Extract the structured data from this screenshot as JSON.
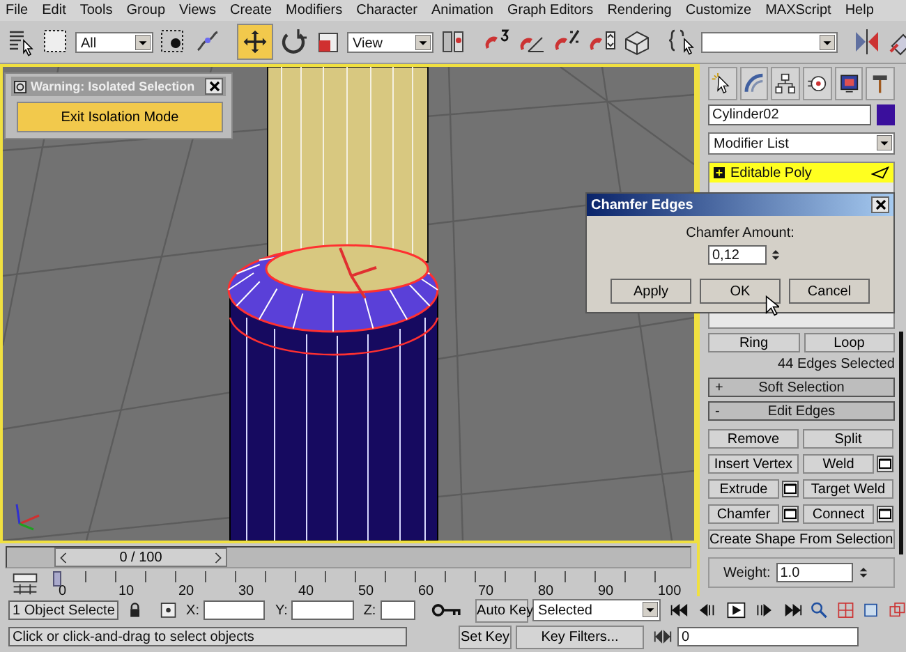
{
  "menu": [
    "File",
    "Edit",
    "Tools",
    "Group",
    "Views",
    "Create",
    "Modifiers",
    "Character",
    "Animation",
    "Graph Editors",
    "Rendering",
    "Customize",
    "MAXScript",
    "Help"
  ],
  "toolbar": {
    "selection_filter": "All",
    "move_tool": {
      "selected": true
    },
    "reference_coordinates": "View"
  },
  "isolation_warning": {
    "title": "Warning: Isolated Selection",
    "button": "Exit Isolation Mode"
  },
  "chamfer_dialog": {
    "title": "Chamfer Edges",
    "label": "Chamfer Amount:",
    "value": "0,12",
    "buttons": [
      "Apply",
      "OK",
      "Cancel"
    ]
  },
  "command_panel": {
    "object_name": "Cylinder02",
    "modifier_list": "Modifier List",
    "stack": [
      {
        "label": "Editable Poly",
        "selected": true
      }
    ],
    "selection_buttons": [
      "Ring",
      "Loop"
    ],
    "selection_info": "44 Edges Selected",
    "rollouts": [
      {
        "sign": "+",
        "title": "Soft Selection"
      },
      {
        "sign": "-",
        "title": "Edit Edges"
      }
    ],
    "edit_edges": [
      {
        "label": "Remove",
        "kind": "half",
        "settings": false
      },
      {
        "label": "Split",
        "kind": "half",
        "settings": false
      },
      {
        "label": "Insert Vertex",
        "kind": "half",
        "settings": false
      },
      {
        "label": "Weld",
        "kind": "half",
        "settings": true
      },
      {
        "label": "Extrude",
        "kind": "half",
        "settings": true
      },
      {
        "label": "Target Weld",
        "kind": "half",
        "settings": false
      },
      {
        "label": "Chamfer",
        "kind": "half",
        "settings": true
      },
      {
        "label": "Connect",
        "kind": "half",
        "settings": true
      },
      {
        "label": "Create Shape From Selection",
        "kind": "full"
      }
    ],
    "weight": {
      "label": "Weight:",
      "value": "1.0"
    }
  },
  "time_slider": {
    "label": "0 / 100"
  },
  "ruler": [
    "0",
    "10",
    "20",
    "30",
    "40",
    "50",
    "60",
    "70",
    "80",
    "90",
    "100"
  ],
  "status_bar": {
    "selection": "1 Object Selecte",
    "x_label": "X:",
    "y_label": "Y:",
    "z_label": "Z:",
    "auto_key": "Auto Key",
    "key_mode": "Selected",
    "set_key": "Set Key",
    "key_filters": "Key Filters...",
    "prompt": "Click or click-and-drag to select objects",
    "frame": "0"
  }
}
